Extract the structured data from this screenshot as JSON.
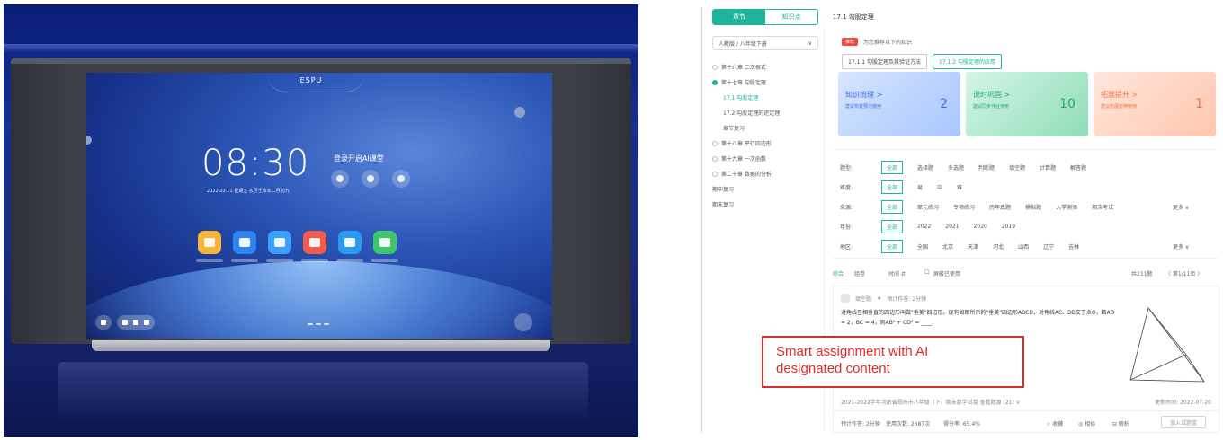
{
  "left_display": {
    "brand": "ESPU",
    "clock": "08:30",
    "date_line": "2022.03.11 星期五 农历壬寅年二月初九",
    "ai_login": "登录开启AI课堂",
    "app_colors": [
      "#f5b43a",
      "#2e84f5",
      "#3aa0ff",
      "#f25c4a",
      "#2a9af0",
      "#3ec46b"
    ]
  },
  "sidebar": {
    "tabs": [
      {
        "label": "章节",
        "active": true
      },
      {
        "label": "知识点",
        "active": false
      }
    ],
    "textbook": "人教版 / 八年级下册",
    "tree": [
      {
        "label": "第十六章 二次根式",
        "kind": "chapter",
        "open": false
      },
      {
        "label": "第十七章 勾股定理",
        "kind": "chapter",
        "open": true
      },
      {
        "label": "17.1 勾股定理",
        "kind": "sub",
        "active": true
      },
      {
        "label": "17.2 勾股定理的逆定理",
        "kind": "sub",
        "active": false
      },
      {
        "label": "章节复习",
        "kind": "sub",
        "active": false
      },
      {
        "label": "第十八章 平行四边形",
        "kind": "chapter",
        "open": false
      },
      {
        "label": "第十九章 一次函数",
        "kind": "chapter",
        "open": false
      },
      {
        "label": "第二十章 数据的分析",
        "kind": "chapter",
        "open": false
      },
      {
        "label": "期中复习",
        "kind": "plain"
      },
      {
        "label": "期末复习",
        "kind": "plain"
      }
    ]
  },
  "content": {
    "title": "17.1 勾股定理",
    "hot_badge": "推荐",
    "hot_text": "为您推荐以下的知识",
    "knowledge_pills": [
      {
        "label": "17.1.1 勾股定理及其验证方法",
        "selected": false
      },
      {
        "label": "17.1.2 勾股定理的应用",
        "selected": true
      }
    ],
    "cards": [
      {
        "title": "知识梳理 >",
        "sub": "建议布置预习使用",
        "num": "2",
        "style": "blue"
      },
      {
        "title": "课时巩固 >",
        "sub": "建议同步作业使用",
        "num": "10",
        "style": "green"
      },
      {
        "title": "拓展提升 >",
        "sub": "建议拓展延伸使用",
        "num": "1",
        "style": "orange"
      }
    ],
    "filters": [
      {
        "label": "题型:",
        "options": [
          "全部",
          "选择题",
          "多选题",
          "判断题",
          "填空题",
          "计算题",
          "解答题"
        ],
        "more": ""
      },
      {
        "label": "难度:",
        "options": [
          "全部",
          "易",
          "中",
          "难"
        ],
        "more": ""
      },
      {
        "label": "来源:",
        "options": [
          "全部",
          "单元练习",
          "专项练习",
          "历年真题",
          "模拟题",
          "入学测验",
          "期末考试"
        ],
        "more": "更多 ∨"
      },
      {
        "label": "年份:",
        "options": [
          "全部",
          "2022",
          "2021",
          "2020",
          "2019"
        ],
        "more": ""
      },
      {
        "label": "地区:",
        "options": [
          "全部",
          "全国",
          "北京",
          "天津",
          "河北",
          "山西",
          "辽宁",
          "吉林"
        ],
        "more": "更多 ∨"
      }
    ],
    "toolbar": {
      "sort_default": "综合",
      "sort_hot": "组卷",
      "sort_time": "时间 ⇵",
      "hide_used": "屏蔽已使用",
      "total": "共211题",
      "pager": "〈  第1/11页  〉"
    },
    "question": {
      "type": "填空题",
      "difficulty": "★",
      "time": "预计作答: 2分钟",
      "text": "对角线互相垂直的四边形叫做\"垂美\"四边形。现有如图所示的\"垂美\"四边形ABCD，对角线AC、BD交于点O，若AD = 2，BC = 4，则AB² + CD² = ____.",
      "source": "2021-2022学年河南省郑州市八年级（下）期末数学试卷  查看题源 (21) ∨",
      "updated": "更新时间: 2022-07-20",
      "footer": {
        "time": "预计作答: 2分钟",
        "used": "使用次数: 2687次",
        "score": "得分率: 65.4%",
        "fav": "☆ 收藏",
        "similar": "◎ 相似",
        "analysis": "⊟ 解析",
        "add": "加入试题篮"
      }
    }
  },
  "callout": {
    "line1": "Smart assignment with AI",
    "line2": "designated content",
    "color": "#e02a2a"
  }
}
